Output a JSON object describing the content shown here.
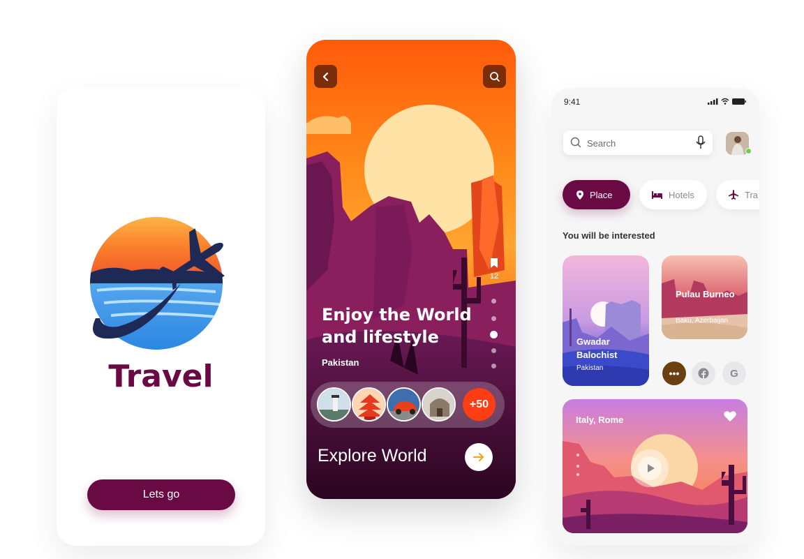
{
  "splash": {
    "brand": "Travel",
    "cta_label": "Lets go",
    "brand_color": "#6a0a45"
  },
  "hero": {
    "title": "Enjoy the World and lifestyle",
    "subtitle": "Pakistan",
    "bookmark_count": "12",
    "gallery_more": "+50",
    "explore_label": "Explore World",
    "accent": "#ff3d14",
    "icons": {
      "back": "chevron-left-icon",
      "search": "search-icon",
      "bookmark": "bookmark-icon",
      "explore": "arrow-right-icon"
    }
  },
  "home": {
    "time": "9:41",
    "search_placeholder": "Search",
    "chips": [
      {
        "label": "Place",
        "icon": "location-pin-icon",
        "active": true
      },
      {
        "label": "Hotels",
        "icon": "bed-icon",
        "active": false
      },
      {
        "label": "Tra",
        "icon": "plane-icon",
        "active": false
      }
    ],
    "section_title": "You will be interested",
    "cards": [
      {
        "title": "Gwadar Balochist",
        "subtitle": "Pakistan"
      },
      {
        "title": "Pulau Burneo",
        "subtitle": "Baku, Azerbaijan"
      },
      {
        "title": "Italy, Rome"
      }
    ],
    "social": {
      "more": "•••",
      "google": "G"
    }
  }
}
